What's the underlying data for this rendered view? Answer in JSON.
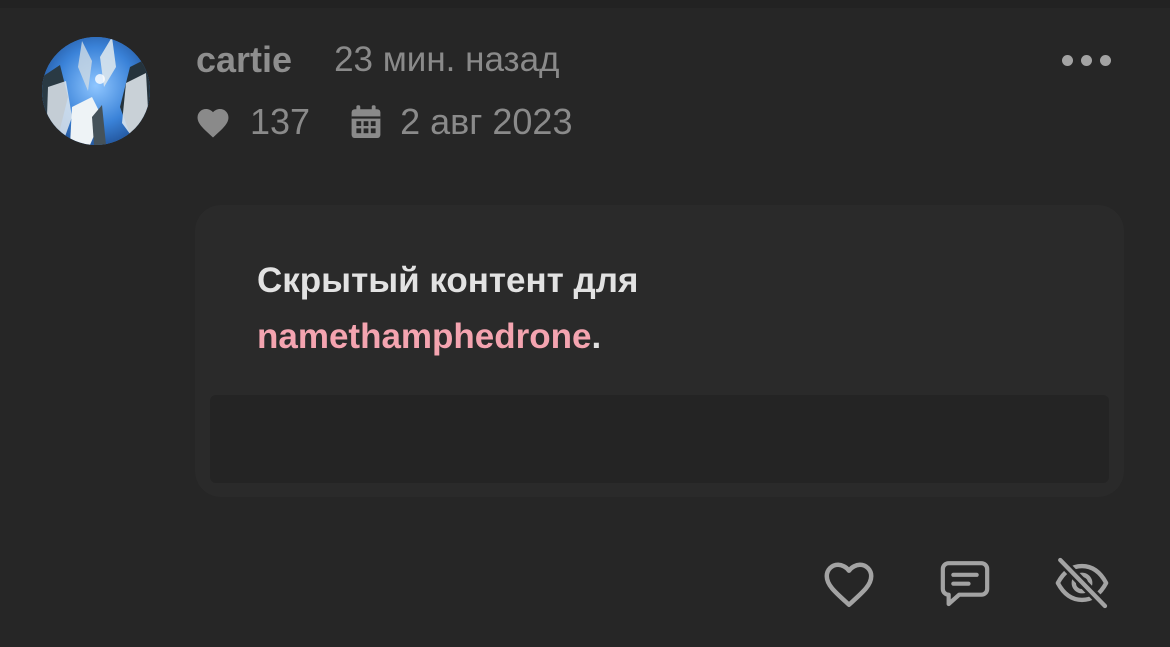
{
  "post": {
    "author": "cartie",
    "time_ago": "23 мин. назад",
    "likes": "137",
    "date": "2 авг 2023",
    "hidden_content": {
      "text_before": "Скрытый контент для",
      "mention": "namethamphedrone",
      "text_after": "."
    }
  },
  "icons": {
    "likes": "heart-icon",
    "date": "calendar-icon",
    "menu": "more-dots-icon",
    "like_action": "heart-outline-icon",
    "reply_action": "comment-icon",
    "hide_action": "eye-off-icon"
  },
  "colors": {
    "background": "#262626",
    "card": "#2a2a2a",
    "muted_text": "#8a8a8a",
    "mention": "#f4a4b0",
    "icon": "#a3a3a3"
  }
}
